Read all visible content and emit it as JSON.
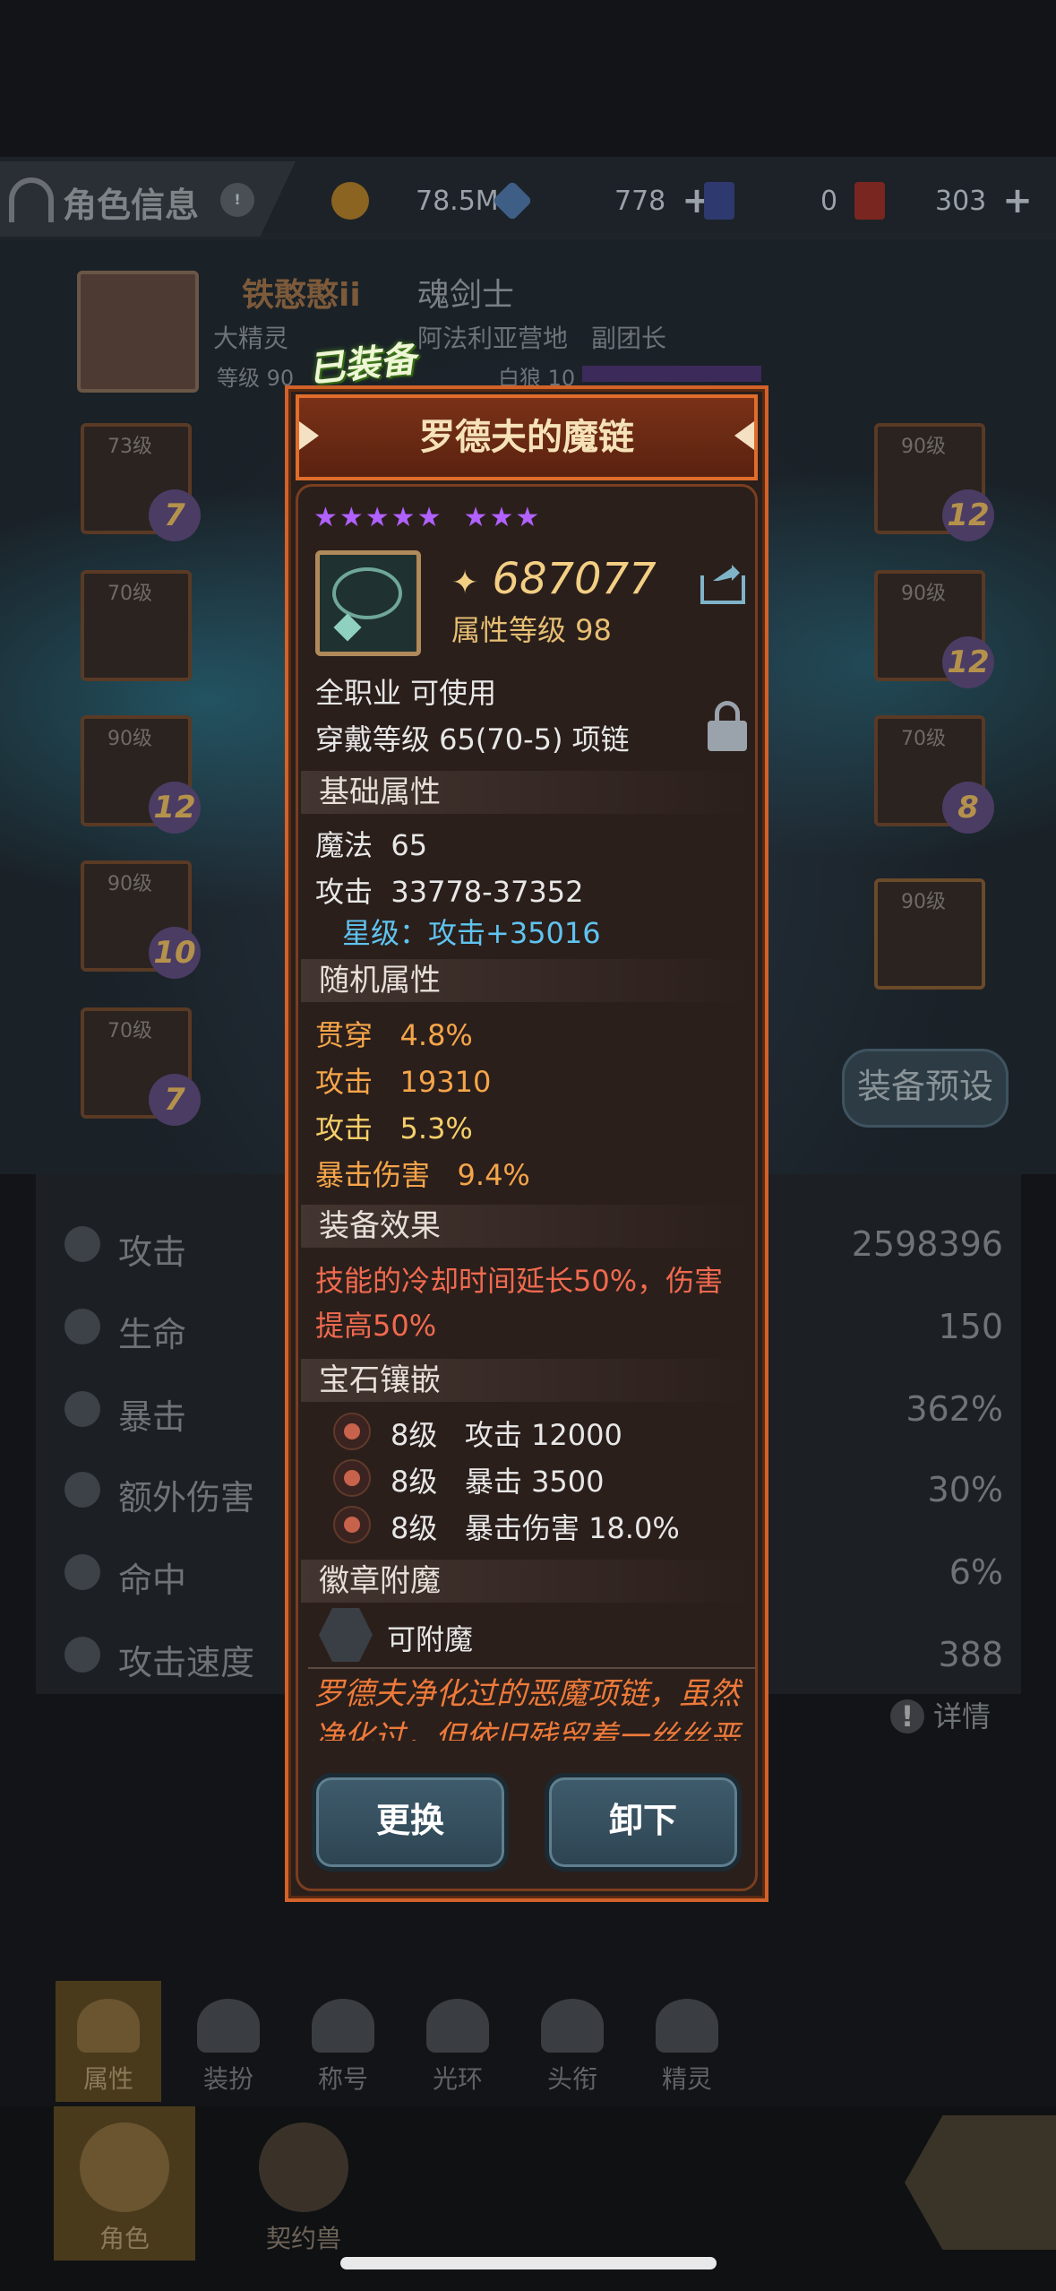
{
  "header": {
    "title": "角色信息",
    "resources": [
      {
        "icon": "gold-coin-icon",
        "value": "78.5M",
        "color": "#c8902a"
      },
      {
        "icon": "crystal-icon",
        "value": "778",
        "color": "#6f9fd6"
      },
      {
        "icon": "ticket-icon",
        "value": "0",
        "color": "#3a4fa6"
      },
      {
        "icon": "gold-card-icon",
        "value": "303",
        "color": "#c8302a"
      }
    ]
  },
  "character": {
    "name": "铁憨憨ii",
    "class": "魂剑士",
    "title_text": "大精灵",
    "guild": "阿法利亚营地",
    "guild_role": "副团长",
    "level_text": "等级 90",
    "sub_text": "白狼 10"
  },
  "equip_slots": [
    {
      "level": "73级",
      "rank": "7"
    },
    {
      "level": "70级",
      "rank": ""
    },
    {
      "level": "90级",
      "rank": "12"
    },
    {
      "level": "90级",
      "rank": "10"
    },
    {
      "level": "70级",
      "rank": "7"
    },
    {
      "level": "90级",
      "rank": "12"
    },
    {
      "level": "90级",
      "rank": "12"
    },
    {
      "level": "70级",
      "rank": "8"
    },
    {
      "level": "90级",
      "rank": ""
    }
  ],
  "preset_button": "装备预设",
  "stats": [
    {
      "label": "攻击",
      "value": "2598396"
    },
    {
      "label": "生命",
      "value": "150"
    },
    {
      "label": "暴击",
      "value": "362%"
    },
    {
      "label": "额外伤害",
      "value": "30%"
    },
    {
      "label": "命中",
      "value": "6%"
    },
    {
      "label": "攻击速度",
      "value": "388"
    }
  ],
  "detail_link": "详情",
  "tabs": [
    {
      "label": "属性",
      "active": true
    },
    {
      "label": "装扮"
    },
    {
      "label": "称号"
    },
    {
      "label": "光环"
    },
    {
      "label": "头衔"
    },
    {
      "label": "精灵"
    }
  ],
  "dock": [
    {
      "label": "角色",
      "active": true
    },
    {
      "label": "契约兽"
    }
  ],
  "popup": {
    "equipped_tag": "已装备",
    "item_name": "罗德夫的魔链",
    "stars_primary": "★★★★★",
    "stars_secondary": "★★★",
    "power": "687077",
    "attr_level": "属性等级 98",
    "usable": "全职业 可使用",
    "wear_req": "穿戴等级 65(70-5) 项链",
    "base_title": "基础属性",
    "base": [
      {
        "name": "魔法",
        "value": "65"
      },
      {
        "name": "攻击",
        "value": "33778-37352"
      }
    ],
    "star_bonus": "星级：攻击+35016",
    "random_title": "随机属性",
    "random": [
      {
        "name": "贯穿",
        "value": "4.8%"
      },
      {
        "name": "攻击",
        "value": "19310"
      },
      {
        "name": "攻击",
        "value": "5.3%"
      },
      {
        "name": "暴击伤害",
        "value": "9.4%"
      }
    ],
    "effect_title": "装备效果",
    "effect_line1": "技能的冷却时间延长50%，伤害",
    "effect_line2": "提高50%",
    "gem_title": "宝石镶嵌",
    "gems": [
      {
        "level": "8级",
        "text": "攻击 12000"
      },
      {
        "level": "8级",
        "text": "暴击 3500"
      },
      {
        "level": "8级",
        "text": "暴击伤害 18.0%"
      }
    ],
    "badge_title": "徽章附魔",
    "badge_text": "可附魔",
    "description": "罗德夫净化过的恶魔项链，虽然净化过，但依旧残留着一丝丝恶",
    "btn_replace": "更换",
    "btn_unequip": "卸下"
  }
}
